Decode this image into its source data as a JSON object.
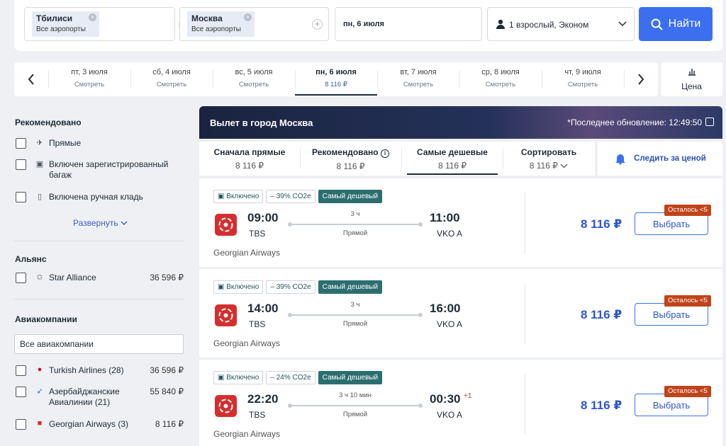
{
  "search": {
    "from_city": "Тбилиси",
    "from_sub": "Все аэропорты",
    "to_city": "Москва",
    "to_sub": "Все аэропорты",
    "date": "пн, 6 июля",
    "passengers": "1 взрослый, Эконом",
    "find_label": "Найти"
  },
  "dates": [
    {
      "day": "пт, 3 июля",
      "sub": "Смотреть"
    },
    {
      "day": "сб, 4 июля",
      "sub": "Смотреть"
    },
    {
      "day": "вс, 5 июля",
      "sub": "Смотреть"
    },
    {
      "day": "пн, 6 июля",
      "sub": "8 116 ₽",
      "active": true
    },
    {
      "day": "вт, 7 июля",
      "sub": "Смотреть"
    },
    {
      "day": "ср, 8 июля",
      "sub": "Смотреть"
    },
    {
      "day": "чт, 9 июля",
      "sub": "Смотреть"
    }
  ],
  "price_toggle": "Цена",
  "sidebar": {
    "recommended_title": "Рекомендовано",
    "recommended": [
      {
        "label": "Прямые",
        "icon": "plane-icon"
      },
      {
        "label": "Включен зарегистрированный багаж",
        "icon": "luggage-icon"
      },
      {
        "label": "Включена ручная кладь",
        "icon": "hand-luggage-icon"
      }
    ],
    "expand_label": "Развернуть",
    "alliance_title": "Альянс",
    "alliances": [
      {
        "label": "Star Alliance",
        "price": "36 596 ₽"
      }
    ],
    "airlines_title": "Авиакомпании",
    "all_airlines": "Все авиакомпании",
    "airlines": [
      {
        "label": "Turkish Airlines (28)",
        "price": "36 596 ₽"
      },
      {
        "label": "Азербайджанские Авиалинии (21)",
        "price": "55 840 ₽"
      },
      {
        "label": "Georgian Airways (3)",
        "price": "8 116 ₽"
      }
    ]
  },
  "banner": {
    "title": "Вылет в город Москва",
    "updated": "*Последнее обновление: 12:49:50"
  },
  "sorts": [
    {
      "label": "Сначала прямые",
      "value": "8 116 ₽"
    },
    {
      "label": "Рекомендовано",
      "value": "8 116 ₽"
    },
    {
      "label": "Самые дешевые",
      "value": "8 116 ₽",
      "active": true
    },
    {
      "label": "Сортировать",
      "value": "8 116 ₽"
    }
  ],
  "track_price": "Следить за ценой",
  "flights": [
    {
      "badge_bag": "Включено",
      "badge_co2": "– 39% CO2e",
      "badge_cheap": "Самый дешевый",
      "dep_time": "09:00",
      "dep_code": "TBS",
      "arr_time": "11:00",
      "arr_code": "VKO A",
      "duration": "3 ч",
      "type": "Прямой",
      "airline": "Georgian Airways",
      "price": "8 116 ₽",
      "select": "Выбрать",
      "left": "Осталось <5",
      "plus_day": ""
    },
    {
      "badge_bag": "Включено",
      "badge_co2": "– 39% CO2e",
      "badge_cheap": "Самый дешевый",
      "dep_time": "14:00",
      "dep_code": "TBS",
      "arr_time": "16:00",
      "arr_code": "VKO A",
      "duration": "3 ч",
      "type": "Прямой",
      "airline": "Georgian Airways",
      "price": "8 116 ₽",
      "select": "Выбрать",
      "left": "Осталось <5",
      "plus_day": ""
    },
    {
      "badge_bag": "Включено",
      "badge_co2": "– 24% CO2e",
      "badge_cheap": "Самый дешевый",
      "dep_time": "22:20",
      "dep_code": "TBS",
      "arr_time": "00:30",
      "arr_code": "VKO A",
      "duration": "3 ч 10 мин",
      "type": "Прямой",
      "airline": "Georgian Airways",
      "price": "8 116 ₽",
      "select": "Выбрать",
      "left": "Осталось <5",
      "plus_day": "+1"
    }
  ],
  "colors": {
    "accent": "#3b6ff0",
    "price": "#2d56c8",
    "badge_dark": "#2c6e70",
    "left_tag": "#c0441b",
    "logo": "#d42e2e"
  }
}
